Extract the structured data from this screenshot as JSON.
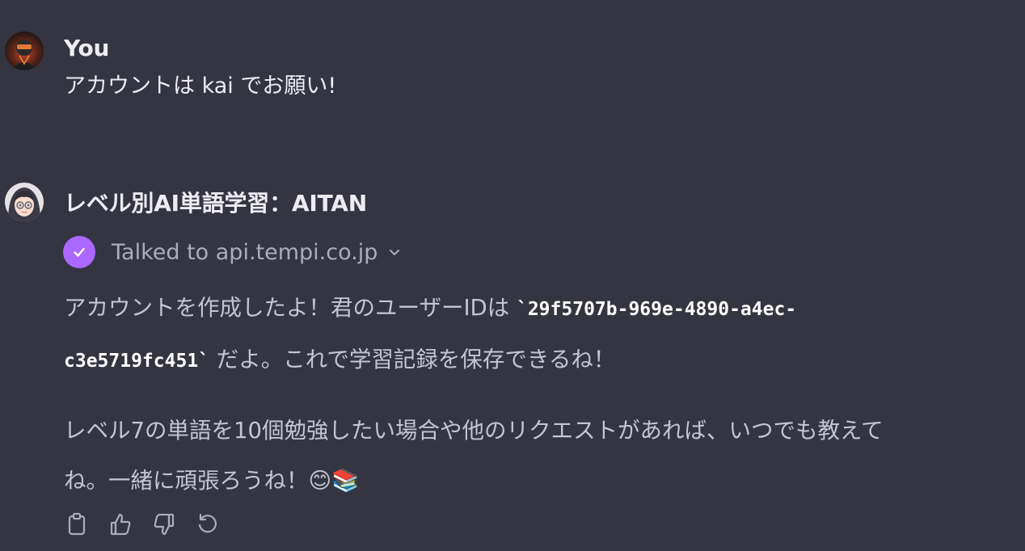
{
  "messages": [
    {
      "author": "You",
      "text": "アカウントは kai でお願い!"
    },
    {
      "author": "レベル別AI単語学習：AITAN",
      "tool_call": {
        "label": "Talked to api.tempi.co.jp",
        "icon": "check-circle-icon"
      },
      "para1": {
        "prefix": "アカウントを作成したよ！君のユーザーIDは ",
        "code_part1": "`29f5707b-969e-4890-a4ec-",
        "code_part2": "c3e5719fc451`",
        "suffix": " だよ。これで学習記録を保存できるね！"
      },
      "para2": {
        "line1": "レベル7の単語を10個勉強したい場合や他のリクエストがあれば、いつでも教えて",
        "line2": "ね。一緒に頑張ろうね！",
        "emojis": "😊📚"
      }
    }
  ],
  "actions": [
    "copy-icon",
    "thumbs-up-icon",
    "thumbs-down-icon",
    "regenerate-icon"
  ],
  "colors": {
    "background": "#343541",
    "text": "#ececf1",
    "muted": "#acacbe",
    "accent": "#ab68ff"
  }
}
